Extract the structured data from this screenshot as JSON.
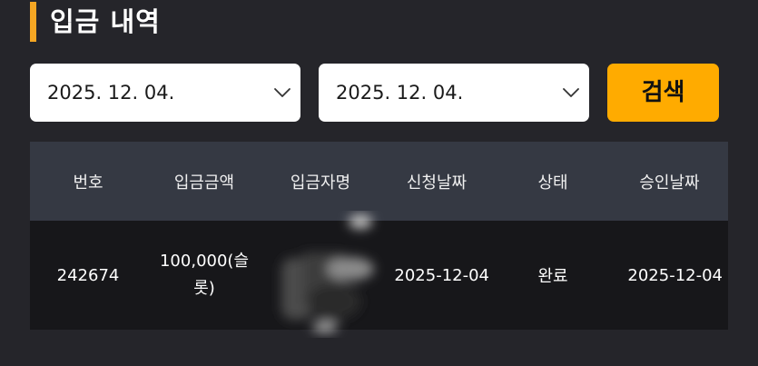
{
  "page": {
    "title": "입금 내역",
    "accent_color": "#ffab00"
  },
  "filters": {
    "start_date": "2025. 12. 04.",
    "end_date": "2025. 12. 04.",
    "dropdown_icon": "chevron-down-icon",
    "search_label": "검색"
  },
  "table": {
    "columns": [
      "번호",
      "입금금액",
      "입금자명",
      "신청날짜",
      "상태",
      "승인날짜"
    ],
    "rows": [
      {
        "number": "242674",
        "amount": "100,000(슬롯)",
        "depositor": "",
        "request_date": "2025-12-04",
        "status": "완료",
        "approval_date": "2025-12-04"
      }
    ]
  }
}
